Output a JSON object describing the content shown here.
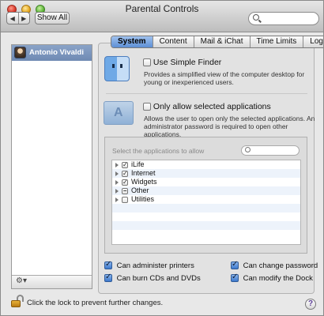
{
  "window": {
    "title": "Parental Controls"
  },
  "toolbar": {
    "back_icon": "◀",
    "forward_icon": "▶",
    "show_all_label": "Show All",
    "search_placeholder": ""
  },
  "sidebar": {
    "users": [
      {
        "name": "Antonio Vivaldi",
        "selected": true
      }
    ],
    "gear_label": "⚙▾"
  },
  "tabs": [
    {
      "label": "System",
      "active": true
    },
    {
      "label": "Content",
      "active": false
    },
    {
      "label": "Mail & iChat",
      "active": false
    },
    {
      "label": "Time Limits",
      "active": false
    },
    {
      "label": "Logs",
      "active": false
    }
  ],
  "system": {
    "simple_finder": {
      "label": "Use Simple Finder",
      "checked": false,
      "description_line1": "Provides a simplified view of the computer desktop for",
      "description_line2": "young or inexperienced users."
    },
    "only_selected_apps": {
      "label": "Only allow selected applications",
      "checked": false,
      "description_line1": "Allows the user to open only the selected applications. An",
      "description_line2": "administrator password is required to open other applications."
    },
    "apps_box": {
      "header": "Select the applications to allow",
      "search_placeholder": "",
      "items": [
        {
          "label": "iLife",
          "state": "checked"
        },
        {
          "label": "Internet",
          "state": "checked"
        },
        {
          "label": "Widgets",
          "state": "checked"
        },
        {
          "label": "Other",
          "state": "mixed"
        },
        {
          "label": "Utilities",
          "state": "unchecked"
        }
      ]
    },
    "permissions": {
      "administer_printers": {
        "label": "Can administer printers",
        "checked": true
      },
      "burn_cds": {
        "label": "Can burn CDs and DVDs",
        "checked": true
      },
      "change_password": {
        "label": "Can change password",
        "checked": true
      },
      "modify_dock": {
        "label": "Can modify the Dock",
        "checked": true
      }
    }
  },
  "footer": {
    "lock_text": "Click the lock to prevent further changes.",
    "help_label": "?"
  },
  "colors": {
    "selection": "#6f8ab3",
    "tab_active": "#5d8fd5",
    "checkbox_blue": "#3c78cc"
  }
}
